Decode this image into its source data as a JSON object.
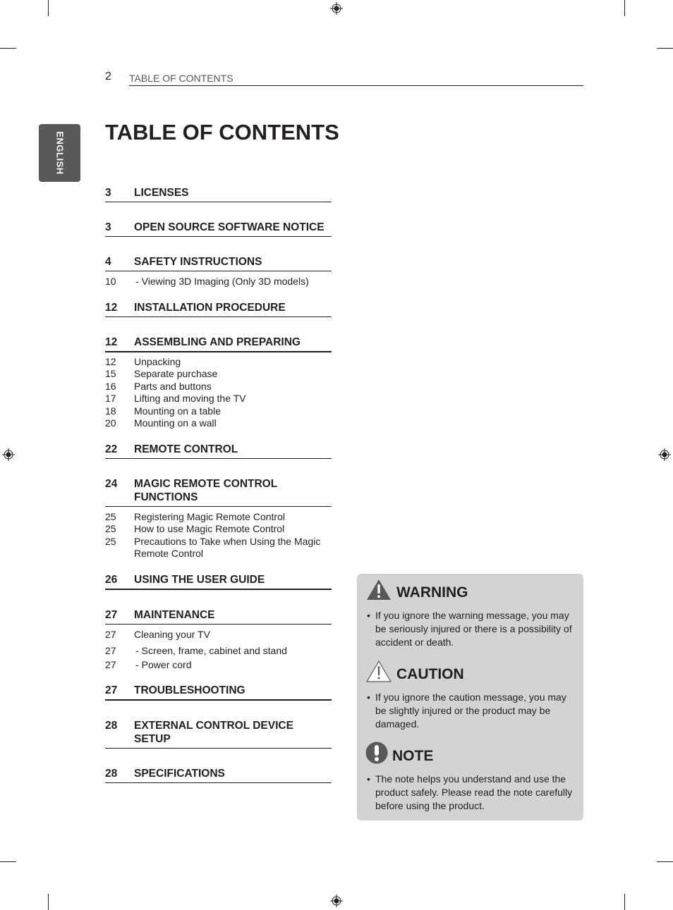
{
  "header": {
    "page_number": "2",
    "running_title": "TABLE OF CONTENTS"
  },
  "language_tab": "ENGLISH",
  "title": "TABLE OF CONTENTS",
  "toc": [
    {
      "page": "3",
      "title": "LICENSES",
      "subs": []
    },
    {
      "page": "3",
      "title": "OPEN SOURCE SOFTWARE NOTICE",
      "subs": []
    },
    {
      "page": "4",
      "title": "SAFETY INSTRUCTIONS",
      "subs": [
        {
          "page": "10",
          "title": "Viewing 3D Imaging (Only 3D models)",
          "dash": true
        }
      ]
    },
    {
      "page": "12",
      "title": "INSTALLATION PROCEDURE",
      "subs": []
    },
    {
      "page": "12",
      "title": "ASSEMBLING AND PREPARING",
      "subs": [
        {
          "page": "12",
          "title": "Unpacking"
        },
        {
          "page": "15",
          "title": "Separate purchase"
        },
        {
          "page": "16",
          "title": "Parts and buttons"
        },
        {
          "page": "17",
          "title": "Lifting and moving the TV"
        },
        {
          "page": "18",
          "title": "Mounting on a table"
        },
        {
          "page": "20",
          "title": "Mounting on a wall"
        }
      ]
    },
    {
      "page": "22",
      "title": "REMOTE CONTROL",
      "subs": []
    },
    {
      "page": "24",
      "title": "MAGIC REMOTE CONTROL FUNCTIONS",
      "subs": [
        {
          "page": "25",
          "title": "Registering Magic Remote Control"
        },
        {
          "page": "25",
          "title": "How to use Magic Remote Control"
        },
        {
          "page": "25",
          "title": "Precautions to Take when Using the Magic Remote Control"
        }
      ]
    },
    {
      "page": "26",
      "title": "USING THE USER GUIDE",
      "subs": []
    },
    {
      "page": "27",
      "title": "MAINTENANCE",
      "subs": [
        {
          "page": "27",
          "title": "Cleaning your TV"
        },
        {
          "page": "27",
          "title": "Screen, frame, cabinet and stand",
          "dash": true
        },
        {
          "page": "27",
          "title": "Power cord",
          "dash": true
        }
      ]
    },
    {
      "page": "27",
      "title": "TROUBLESHOOTING",
      "subs": []
    },
    {
      "page": "28",
      "title": "EXTERNAL CONTROL DEVICE SETUP",
      "subs": []
    },
    {
      "page": "28",
      "title": "SPECIFICATIONS",
      "subs": []
    }
  ],
  "notices": {
    "warning": {
      "icon": "warning-triangle-filled",
      "title": "WARNING",
      "text": "If you ignore the warning message, you may be seriously injured or there is a possibility of accident or death."
    },
    "caution": {
      "icon": "caution-triangle-outline",
      "title": "CAUTION",
      "text": "If you ignore the caution message, you may be slightly injured or the product may be damaged."
    },
    "note": {
      "icon": "note-exclamation-circle",
      "title": "NOTE",
      "text": "The note helps you understand and use the product safely. Please read the note carefully before using the product."
    }
  },
  "colors": {
    "text": "#231f20",
    "tab": "#58595b",
    "box": "#d1d3d4"
  }
}
